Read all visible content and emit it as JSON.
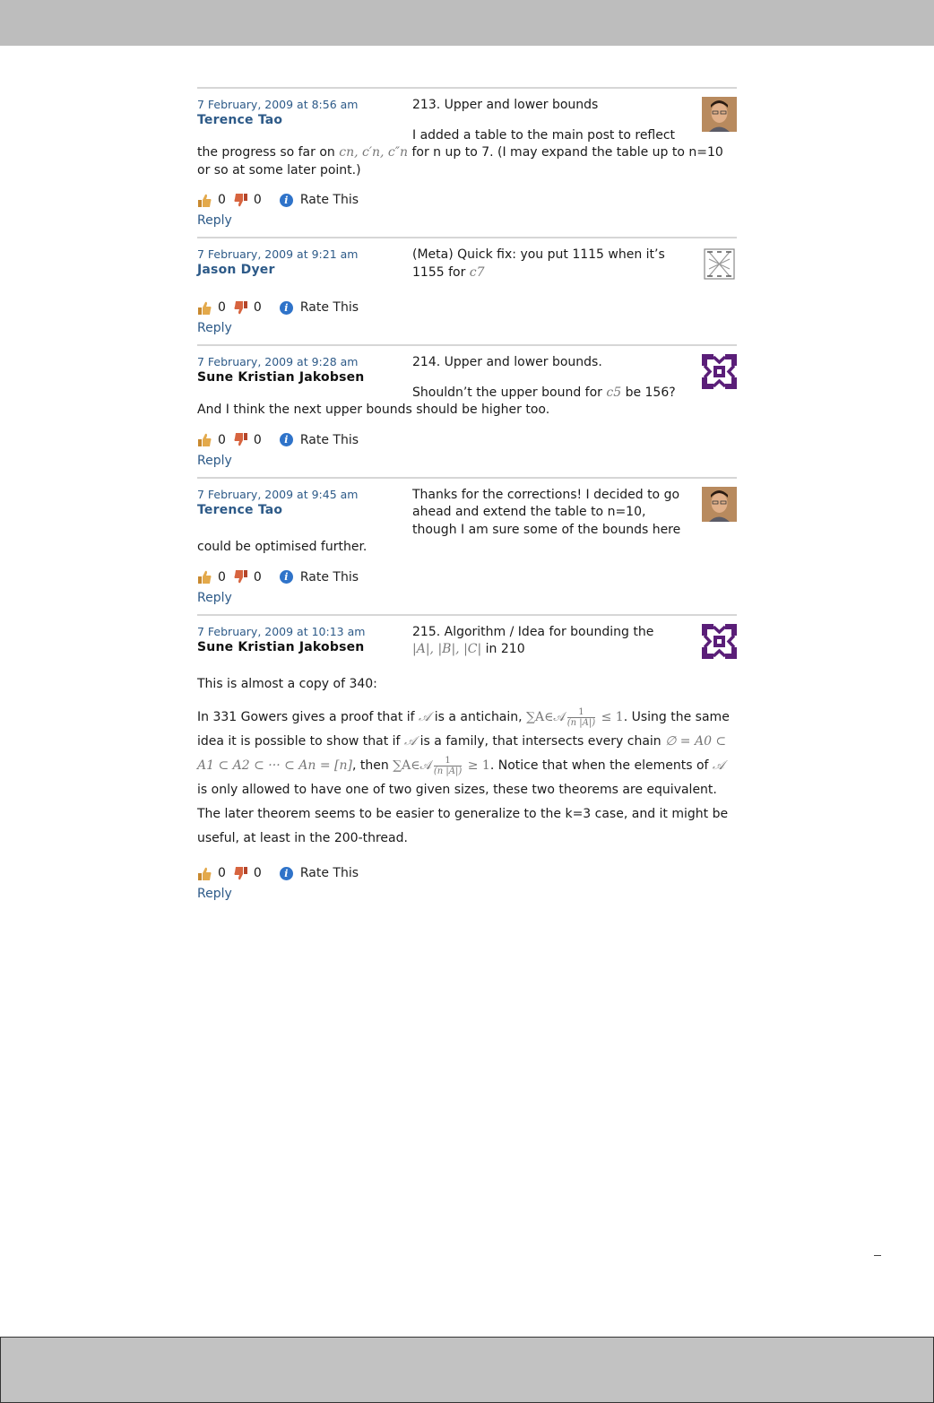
{
  "actions": {
    "up_count": "0",
    "down_count": "0",
    "rate_label": "Rate This",
    "reply_label": "Reply"
  },
  "comments": [
    {
      "date": "7 February, 2009 at 8:56 am",
      "author": "Terence Tao",
      "title": "213. Upper and lower bounds",
      "right_text": "I added a table to the main post to reflect",
      "full_text_a": "the progress so far on ",
      "math_a": "cn, c′n, c″n",
      "full_text_b": " for n up to 7. (I may expand the table up to n=10 or so at some later point.)"
    },
    {
      "date": "7 February, 2009 at 9:21 am",
      "author": "Jason Dyer",
      "text_a": "(Meta) Quick fix: you put 1115 when it’s 1155 for ",
      "math_a": "c7"
    },
    {
      "date": "7 February, 2009 at 9:28 am",
      "author": "Sune Kristian Jakobsen",
      "title": "214. Upper and lower bounds.",
      "right_text_a": "Shouldn’t the upper bound for ",
      "math_a": "c5",
      "right_text_b": " be 156?",
      "full_text": "And I think the next upper bounds should be higher too."
    },
    {
      "date": "7 February, 2009 at 9:45 am",
      "author": "Terence Tao",
      "right_text": "Thanks for the corrections! I decided to go ahead and extend the table to n=10, though I am sure some of the bounds here",
      "full_text": "could be optimised further."
    },
    {
      "date": "7 February, 2009 at 10:13 am",
      "author": "Sune Kristian Jakobsen",
      "title_a": "215. Algorithm / Idea for bounding the",
      "math_a": "|A|, |B|, |C|",
      "title_b": " in 210",
      "p1": "This is almost a copy of 340:",
      "p2_a": "In 331 Gowers gives a proof that if ",
      "math_calA": "𝒜",
      "p2_b": " is a antichain, ",
      "math_sum": "∑A∈𝒜",
      "frac_num": "1",
      "frac_den": "(n |A|)",
      "math_le": " ≤ 1",
      "p2_c": ". Using the same idea it is possible to show that if ",
      "p2_d": " is a family, that intersects every chain ",
      "math_chain": "∅ = A0 ⊂ A1 ⊂ A2 ⊂ ··· ⊂ An = [n]",
      "p2_e": ", then ",
      "math_ge": " ≥ 1",
      "p2_f": ". Notice that when the elements of ",
      "p2_g": " is only allowed to have one of two given sizes, these two theorems are equivalent. The later theorem seems to be easier to generalize to the k=3 case, and it might be useful, at least in the 200-thread."
    }
  ]
}
